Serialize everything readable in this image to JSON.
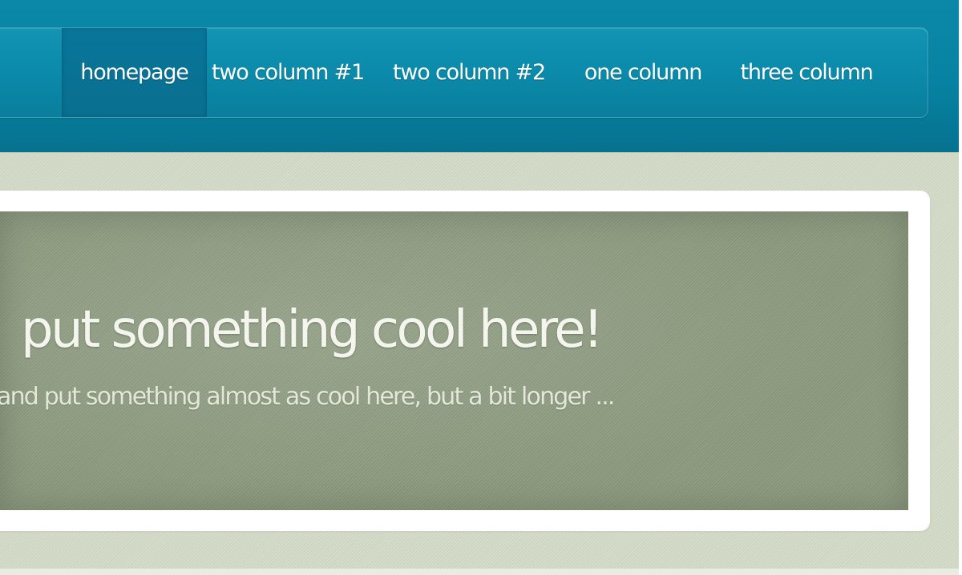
{
  "nav": {
    "items": [
      {
        "label": "homepage",
        "active": true
      },
      {
        "label": "two column #1",
        "active": false
      },
      {
        "label": "two column #2",
        "active": false
      },
      {
        "label": "one column",
        "active": false
      },
      {
        "label": "three column",
        "active": false
      }
    ]
  },
  "hero": {
    "title": "put something cool here!",
    "subtitle": "and put something almost as cool here, but a bit longer ..."
  },
  "colors": {
    "header": "#0782a2",
    "page_background": "#d3dac6",
    "hero_background": "#8c9a7e",
    "frame": "#ffffff",
    "text": "#ffffff"
  }
}
